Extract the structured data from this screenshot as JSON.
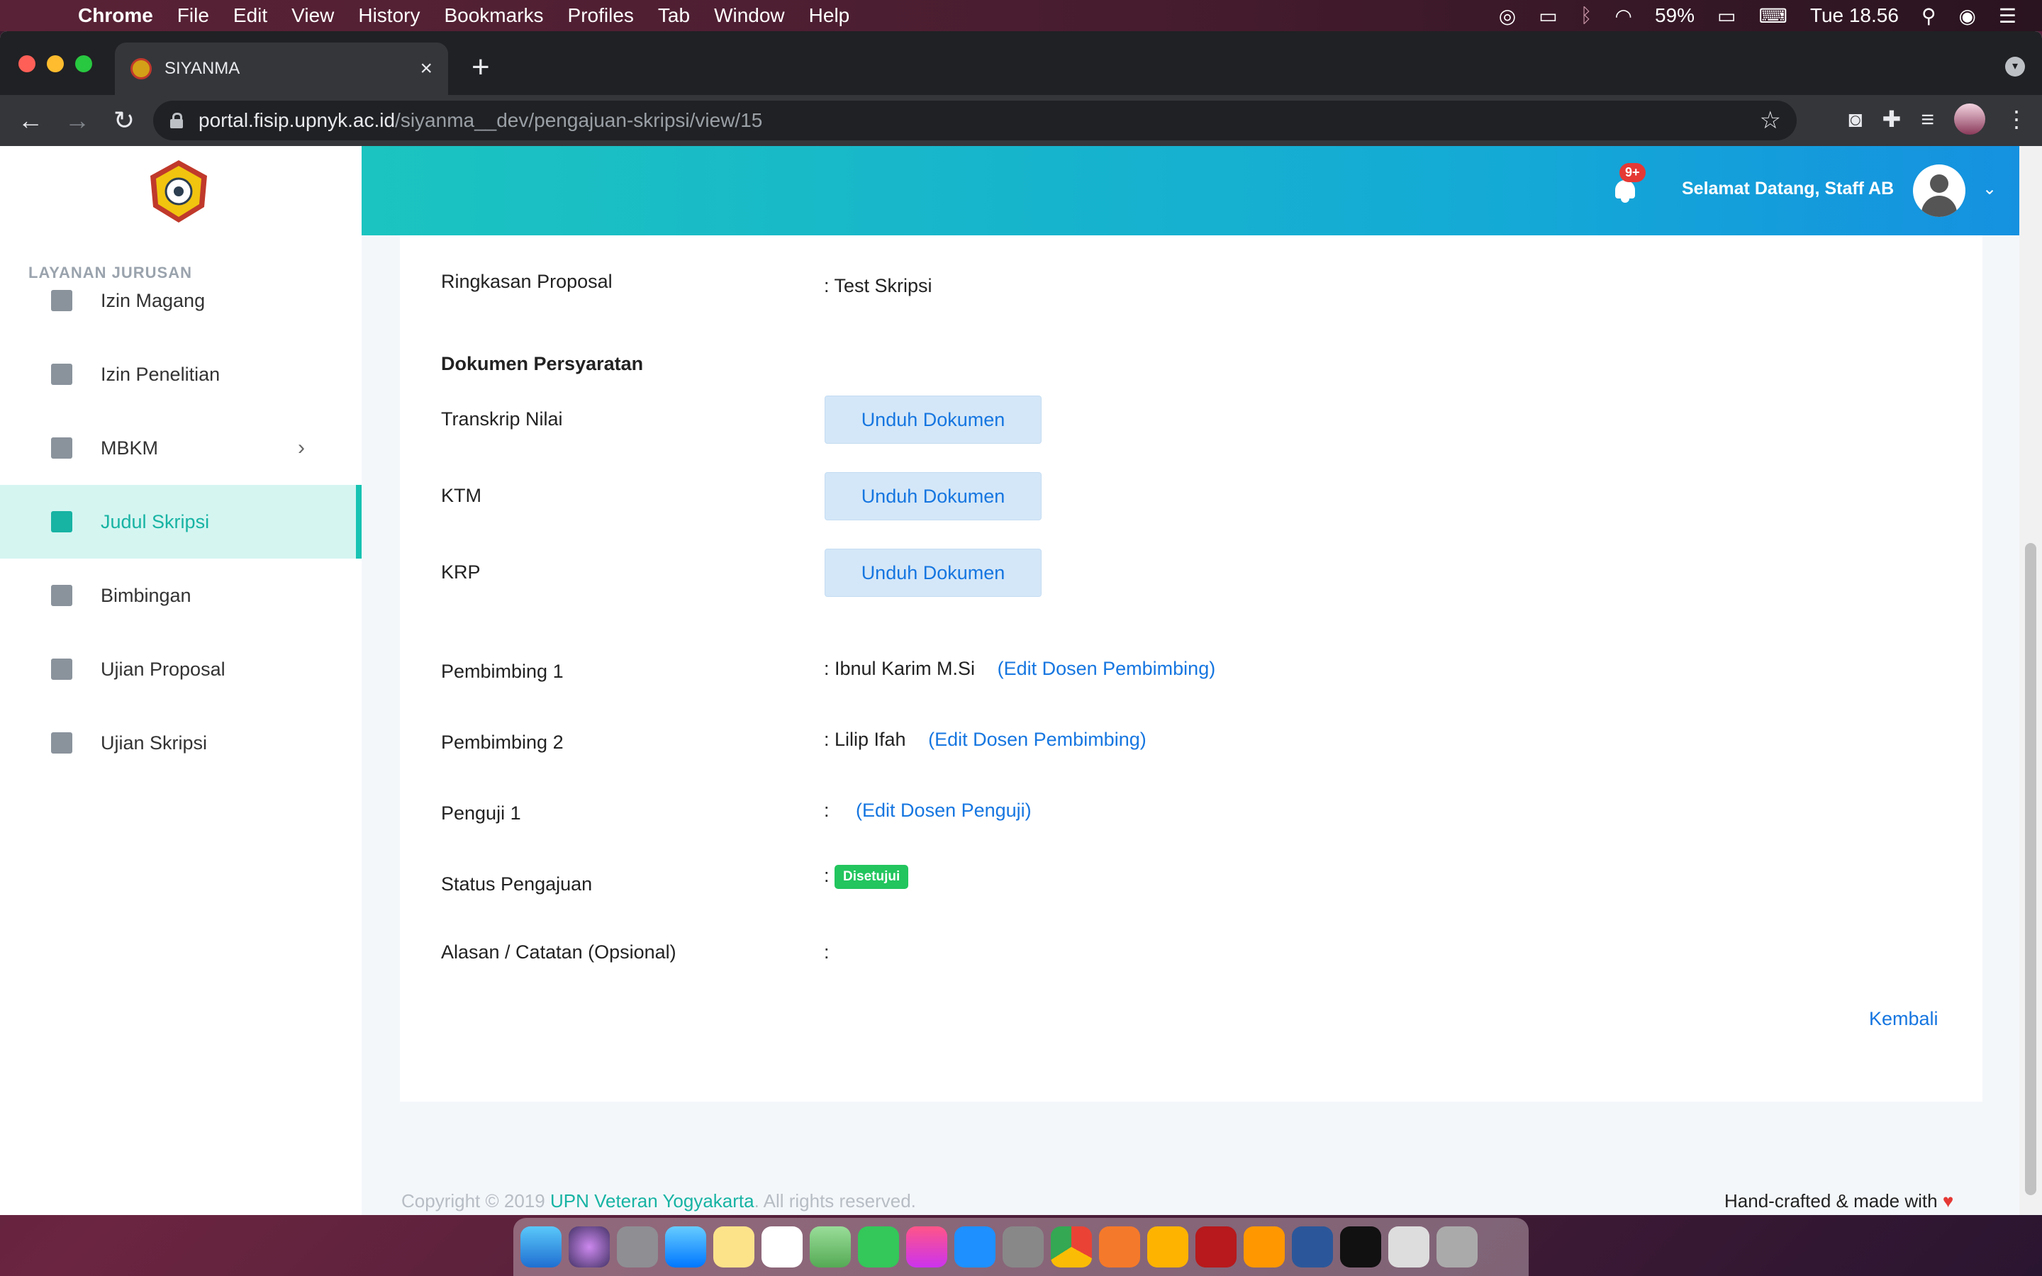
{
  "menubar": {
    "app": "Chrome",
    "items": [
      "File",
      "Edit",
      "View",
      "History",
      "Bookmarks",
      "Profiles",
      "Tab",
      "Window",
      "Help"
    ],
    "battery": "59%",
    "clock": "Tue 18.56"
  },
  "browser": {
    "tab_title": "SIYANMA",
    "url_host": "portal.fisip.upnyk.ac.id",
    "url_path": "/siyanma__dev/pengajuan-skripsi/view/15"
  },
  "sidebar": {
    "brand": "LAYANAN JURUSAN",
    "items": [
      {
        "label": "Izin Magang"
      },
      {
        "label": "Izin Penelitian"
      },
      {
        "label": "MBKM"
      },
      {
        "label": "Judul Skripsi"
      },
      {
        "label": "Bimbingan"
      },
      {
        "label": "Ujian Proposal"
      },
      {
        "label": "Ujian Skripsi"
      }
    ]
  },
  "header": {
    "notif_badge": "9+",
    "welcome": "Selamat Datang, Staff AB"
  },
  "detail": {
    "ringkasan_label": "Ringkasan Proposal",
    "ringkasan_value": ": Test Skripsi",
    "docs_heading": "Dokumen Persyaratan",
    "docs": [
      {
        "label": "Transkrip Nilai",
        "button": "Unduh Dokumen"
      },
      {
        "label": "KTM",
        "button": "Unduh Dokumen"
      },
      {
        "label": "KRP",
        "button": "Unduh Dokumen"
      }
    ],
    "pembimbing1_label": "Pembimbing 1",
    "pembimbing1_value": ": Ibnul Karim M.Si",
    "pembimbing1_link": "(Edit Dosen Pembimbing)",
    "pembimbing2_label": "Pembimbing 2",
    "pembimbing2_value": ": Lilip Ifah",
    "pembimbing2_link": "(Edit Dosen Pembimbing)",
    "penguji1_label": "Penguji 1",
    "penguji1_value": ":",
    "penguji1_link": "(Edit Dosen Penguji)",
    "status_label": "Status Pengajuan",
    "status_colon": ":",
    "status_value": "Disetujui",
    "alasan_label": "Alasan / Catatan (Opsional)",
    "alasan_value": ":",
    "back": "Kembali"
  },
  "footer": {
    "copy_prefix": "Copyright © 2019",
    "copy_brand": "UPN Veteran Yogyakarta",
    "copy_suffix": ". All rights reserved.",
    "right": "Hand-crafted & made with"
  }
}
